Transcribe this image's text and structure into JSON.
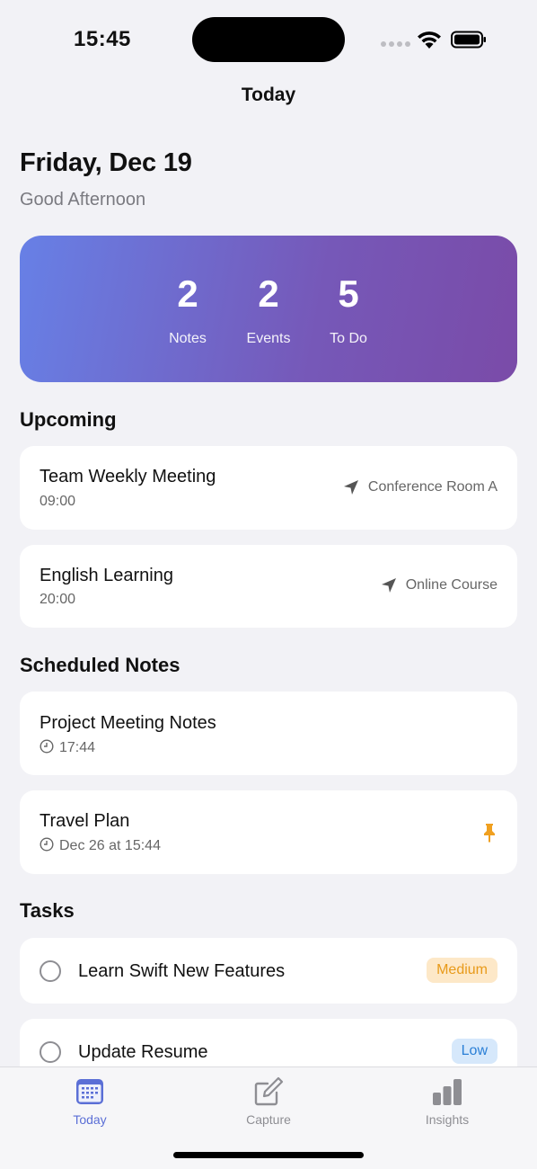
{
  "status": {
    "time": "15:45"
  },
  "nav": {
    "title": "Today"
  },
  "header": {
    "date": "Friday, Dec 19",
    "greeting": "Good Afternoon"
  },
  "summary": {
    "stats": [
      {
        "value": "2",
        "label": "Notes"
      },
      {
        "value": "2",
        "label": "Events"
      },
      {
        "value": "5",
        "label": "To Do"
      }
    ]
  },
  "upcoming": {
    "title": "Upcoming",
    "items": [
      {
        "title": "Team Weekly Meeting",
        "time": "09:00",
        "location": "Conference Room A"
      },
      {
        "title": "English Learning",
        "time": "20:00",
        "location": "Online Course"
      }
    ]
  },
  "scheduled": {
    "title": "Scheduled Notes",
    "items": [
      {
        "title": "Project Meeting Notes",
        "time": "17:44",
        "pinned": false
      },
      {
        "title": "Travel Plan",
        "time": "Dec 26 at 15:44",
        "pinned": true
      }
    ]
  },
  "tasks": {
    "title": "Tasks",
    "items": [
      {
        "label": "Learn Swift New Features",
        "priority": "Medium"
      },
      {
        "label": "Update Resume",
        "priority": "Low"
      }
    ]
  },
  "tabs": [
    {
      "label": "Today",
      "icon": "calendar-icon",
      "active": true
    },
    {
      "label": "Capture",
      "icon": "compose-icon",
      "active": false
    },
    {
      "label": "Insights",
      "icon": "bar-chart-icon",
      "active": false
    }
  ],
  "colors": {
    "accent": "#5b6fd6",
    "gradient_start": "#6780e6",
    "gradient_end": "#7a4ba8",
    "pin": "#f0a020",
    "medium_badge": "#fde8c8",
    "low_badge": "#d6e8fb"
  }
}
